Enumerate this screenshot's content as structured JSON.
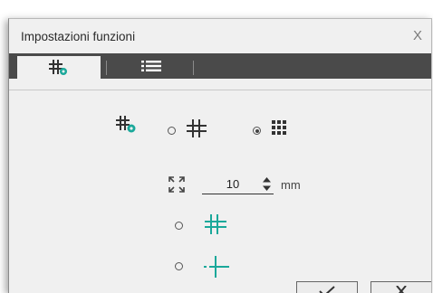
{
  "dialog": {
    "title": "Impostazioni funzioni",
    "close_label": "X"
  },
  "tabs": [
    {
      "icon": "grid-settings-icon",
      "selected": true
    },
    {
      "icon": "list-icon",
      "selected": false
    }
  ],
  "grid": {
    "types": [
      {
        "icon": "grid-lines-icon",
        "selected": false
      },
      {
        "icon": "grid-dots-icon",
        "selected": true
      }
    ],
    "spacing": {
      "value": "10",
      "unit": "mm",
      "icon": "expand-icon"
    },
    "styles": [
      {
        "icon": "grid-offset-icon",
        "selected": false
      },
      {
        "icon": "crosshair-icon",
        "selected": false
      }
    ]
  },
  "buttons": {
    "ok_icon": "checkmark-icon",
    "cancel_icon": "close-icon"
  },
  "colors": {
    "accent": "#1aa89a",
    "icon_dark": "#333333",
    "tabbar": "#4a4a4a"
  }
}
